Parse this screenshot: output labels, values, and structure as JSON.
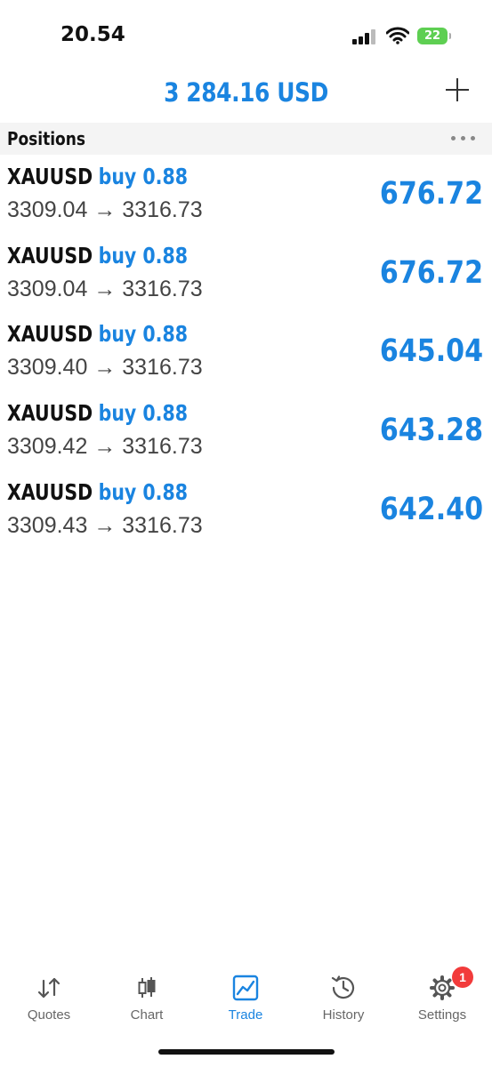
{
  "status_bar": {
    "time": "20.54",
    "battery": "22"
  },
  "header": {
    "balance": "3 284.16 USD"
  },
  "section": {
    "title": "Positions"
  },
  "positions": [
    {
      "symbol": "XAUUSD",
      "direction": "buy 0.88",
      "prices": "3309.04 → 3316.73",
      "profit": "676.72"
    },
    {
      "symbol": "XAUUSD",
      "direction": "buy 0.88",
      "prices": "3309.04 → 3316.73",
      "profit": "676.72"
    },
    {
      "symbol": "XAUUSD",
      "direction": "buy 0.88",
      "prices": "3309.40 → 3316.73",
      "profit": "645.04"
    },
    {
      "symbol": "XAUUSD",
      "direction": "buy 0.88",
      "prices": "3309.42 → 3316.73",
      "profit": "643.28"
    },
    {
      "symbol": "XAUUSD",
      "direction": "buy 0.88",
      "prices": "3309.43 → 3316.73",
      "profit": "642.40"
    }
  ],
  "tabs": [
    {
      "label": "Quotes",
      "icon": "quotes-arrows-icon"
    },
    {
      "label": "Chart",
      "icon": "candlestick-chart-icon"
    },
    {
      "label": "Trade",
      "icon": "trade-chart-icon",
      "active": true
    },
    {
      "label": "History",
      "icon": "history-clock-icon"
    },
    {
      "label": "Settings",
      "icon": "gear-icon",
      "badge": "1"
    }
  ],
  "colors": {
    "accent": "#1a84e0",
    "badge": "#f23b3b",
    "battery": "#5ecf52"
  }
}
